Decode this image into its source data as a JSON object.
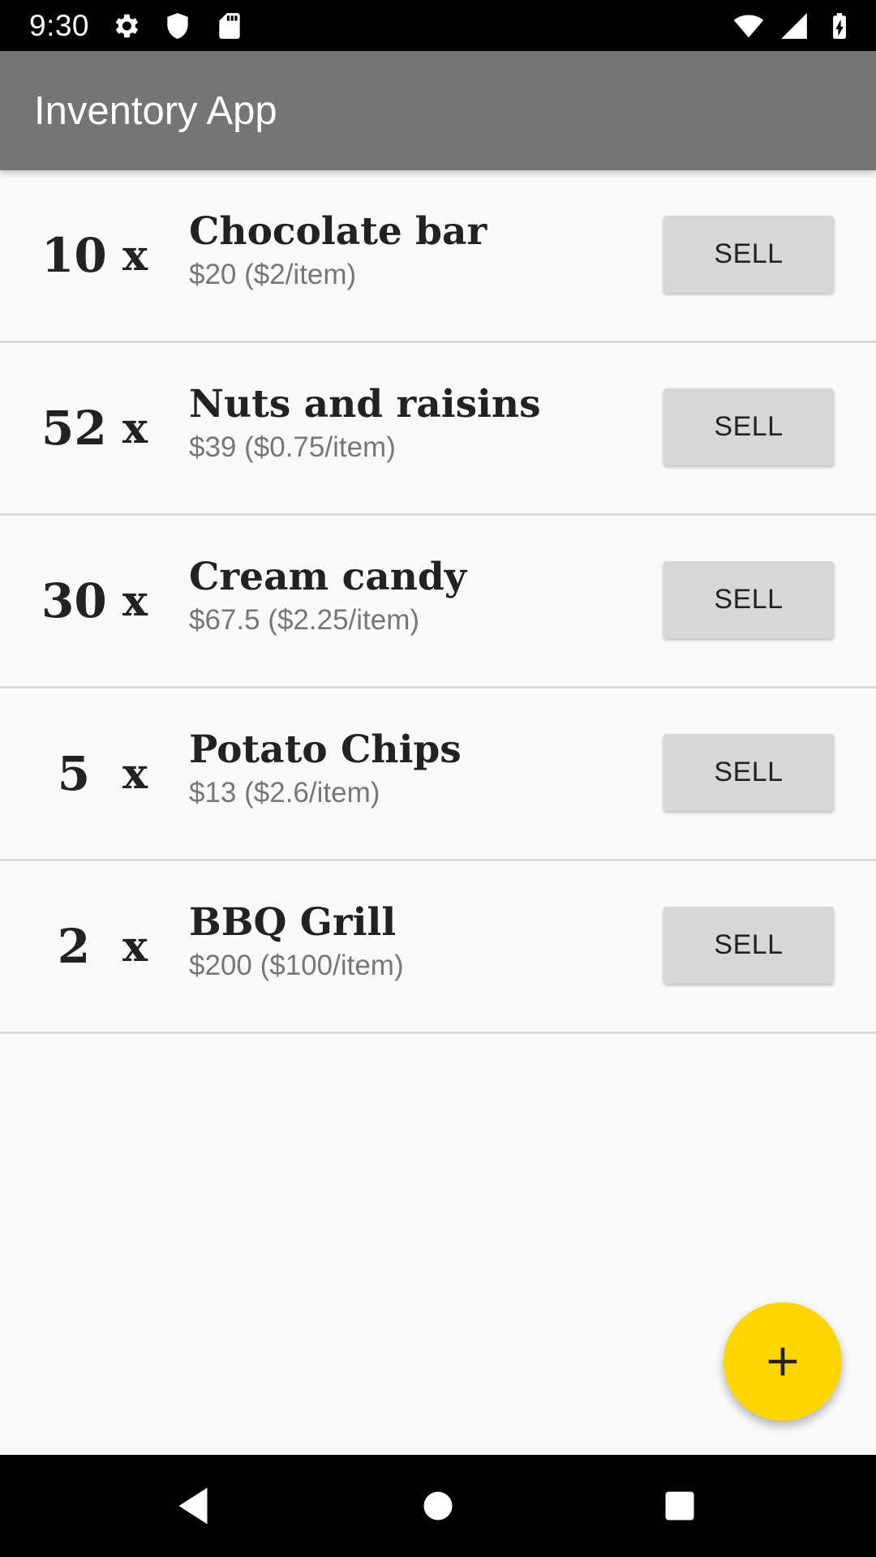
{
  "status_bar": {
    "time": "9:30",
    "left_icons": [
      "gear-icon",
      "shield-icon",
      "sd-card-icon"
    ],
    "right_icons": [
      "wifi-icon",
      "cell-signal-icon",
      "battery-charging-icon"
    ]
  },
  "app_bar": {
    "title": "Inventory App",
    "color": "#757575"
  },
  "items": [
    {
      "quantity": "10",
      "x": "x",
      "name": "Chocolate bar",
      "price": "$20 ($2/item)",
      "sell_label": "SELL"
    },
    {
      "quantity": "52",
      "x": "x",
      "name": "Nuts and raisins",
      "price": "$39 ($0.75/item)",
      "sell_label": "SELL"
    },
    {
      "quantity": "30",
      "x": "x",
      "name": "Cream candy",
      "price": "$67.5 ($2.25/item)",
      "sell_label": "SELL"
    },
    {
      "quantity": "5",
      "x": "x",
      "name": "Potato Chips",
      "price": "$13 ($2.6/item)",
      "sell_label": "SELL"
    },
    {
      "quantity": "2",
      "x": "x",
      "name": "BBQ Grill",
      "price": "$200 ($100/item)",
      "sell_label": "SELL"
    }
  ],
  "fab": {
    "icon": "plus-icon",
    "color": "#ffd600"
  },
  "nav_bar": {
    "icons": [
      "back-icon",
      "home-icon",
      "recents-icon"
    ]
  }
}
